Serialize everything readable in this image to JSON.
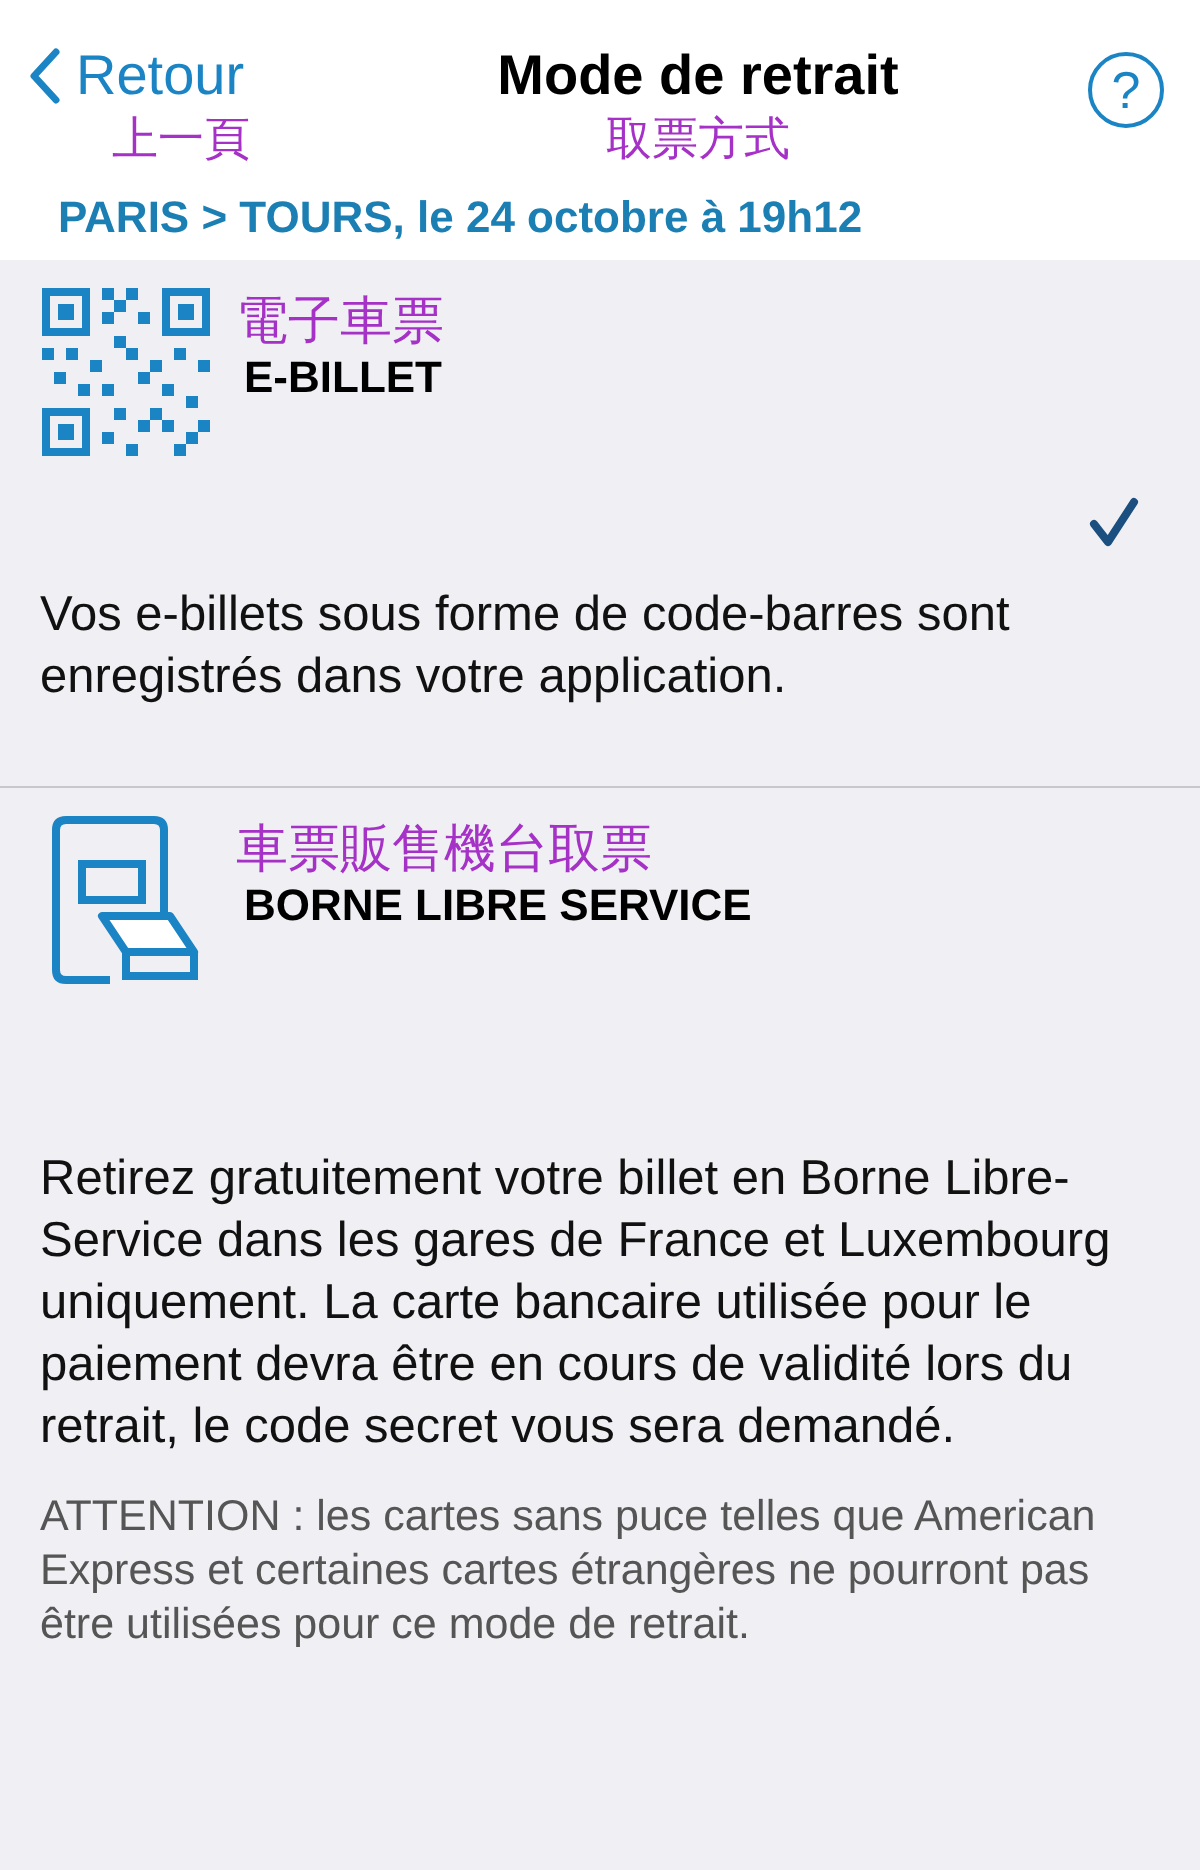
{
  "header": {
    "back_label": "Retour",
    "back_annotation": "上一頁",
    "title": "Mode de retrait",
    "title_annotation": "取票方式",
    "help": "?"
  },
  "route": "PARIS > TOURS, le 24 octobre à 19h12",
  "options": [
    {
      "kind": "qr",
      "annotation": "電子車票",
      "label": "E-BILLET",
      "selected": true,
      "description": "Vos e-billets sous forme de code-barres sont enregistrés dans votre application."
    },
    {
      "kind": "kiosk",
      "annotation": "車票販售機台取票",
      "label": "BORNE LIBRE SERVICE",
      "selected": false,
      "description": "Retirez gratuitement votre billet en Borne Libre-Service dans les gares de France et Luxembourg uniquement. La carte bancaire utilisée pour le paiement devra être en cours de validité lors du retrait, le code secret vous sera demandé.",
      "note": "ATTENTION : les cartes sans puce telles que American Express et certaines cartes étrangères ne pourront pas être utilisées pour ce mode de retrait."
    }
  ]
}
